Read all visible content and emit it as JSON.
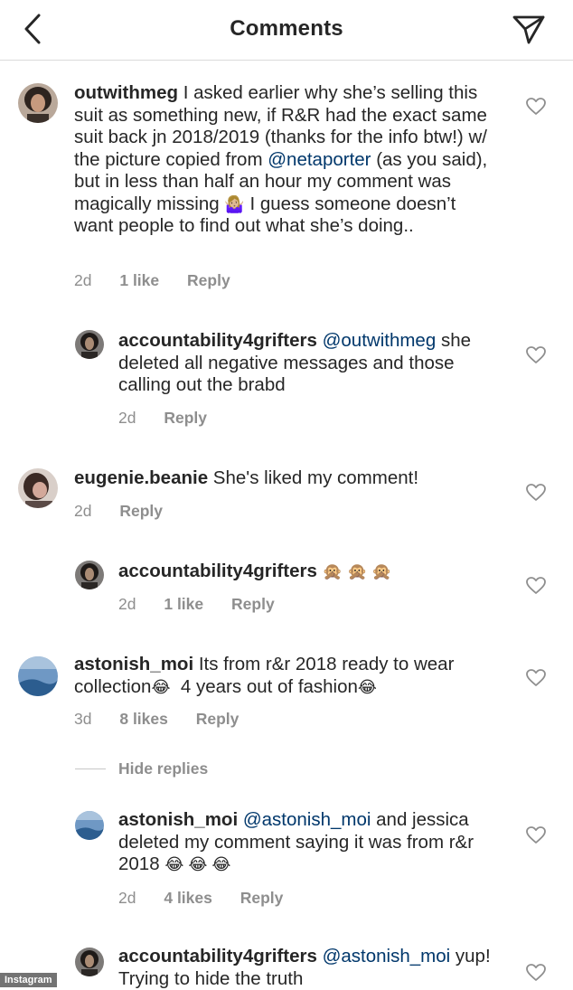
{
  "header": {
    "title": "Comments"
  },
  "comments": [
    {
      "username": "outwithmeg",
      "text": " I asked earlier why she’s selling this suit as something new, if R&R had the exact same suit back jn 2018/2019 (thanks for the info btw!) w/ the picture copied from ",
      "mention": "@netaporter",
      "text2": " (as you said), but in less than half an hour my comment was magically missing ",
      "emoji": "🤷🏼‍♀️",
      "text3": " I guess someone doesn’t want people to find out what she’s doing..",
      "time": "2d",
      "likes": "1 like",
      "reply": "Reply"
    },
    {
      "username": "accountability4grifters",
      "mention": "@outwithmeg",
      "text": "she deleted all negative messages and those calling out the brabd",
      "time": "2d",
      "reply": "Reply"
    },
    {
      "username": "eugenie.beanie",
      "text": " She's liked my comment!",
      "time": "2d",
      "reply": "Reply"
    },
    {
      "username": "accountability4grifters",
      "emoji": "🙊 🙊 🙊",
      "time": "2d",
      "likes": "1 like",
      "reply": "Reply"
    },
    {
      "username": "astonish_moi",
      "text": " Its from r&r 2018 ready to wear collection",
      "emoji": "😂",
      "text2": "  4 years out of fashion",
      "emoji2": "😂",
      "time": "3d",
      "likes": "8 likes",
      "reply": "Reply"
    },
    {
      "username": "astonish_moi",
      "mention": "@astonish_moi",
      "text": " and jessica deleted my comment saying it was from r&r 2018 ",
      "emoji": "😂 😂 😂",
      "time": "2d",
      "likes": "4 likes",
      "reply": "Reply"
    },
    {
      "username": "accountability4grifters",
      "mention": "@astonish_moi",
      "text": "yup! Trying to hide the truth"
    }
  ],
  "hide_replies": "Hide replies",
  "watermark": "Instagram"
}
